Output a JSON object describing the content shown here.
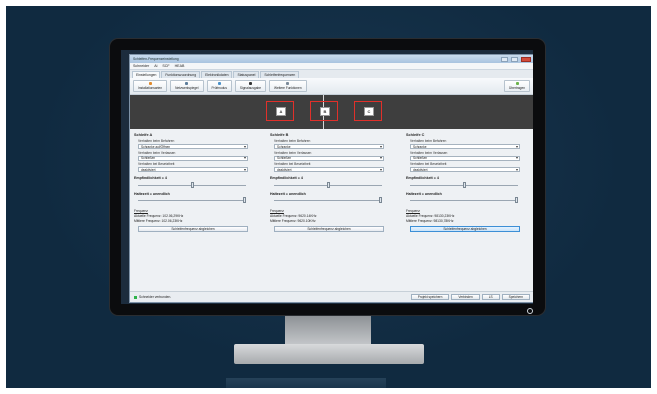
{
  "window": {
    "title": "Schleifen-Frequenzeinstellung"
  },
  "menu": [
    "Schneider",
    "Ai",
    "SCF",
    "HEAB"
  ],
  "tabs": [
    "Einstellungen",
    "Funktionszuordnung",
    "Elektronikdaten",
    "Statuspanel",
    "Schleifenfrequenzen"
  ],
  "toolbar": {
    "buttons": [
      {
        "label": "Installationsarten",
        "icon": "installation-icon",
        "color": "#e08a2c"
      },
      {
        "label": "Netzwerkspiegel",
        "icon": "network-icon",
        "color": "#5c7c9a"
      },
      {
        "label": "Prüfmodus",
        "icon": "test-icon",
        "color": "#4a90c8"
      },
      {
        "label": "Signalausgabe",
        "icon": "signal-icon",
        "color": "#333333"
      },
      {
        "label": "Weitere Funktionen",
        "icon": "more-icon",
        "color": "#7a8a99"
      }
    ],
    "right_button": {
      "label": "Übertragen",
      "icon": "transfer-icon",
      "color": "#6bb34a"
    }
  },
  "zones": [
    "A",
    "B",
    "C"
  ],
  "loops": [
    {
      "title": "Schleife A",
      "rows": [
        {
          "label": "Verhalten beim Befahren",
          "value": "Schranke auf/Öffnen"
        },
        {
          "label": "Verhalten beim Verlassen",
          "value": "Schließen"
        },
        {
          "label": "Verhalten bei Besetztheit",
          "value": "deaktiviert"
        }
      ],
      "sensitivity_label": "Empfindlichkeit = 4",
      "sensitivity_level": 0.5,
      "hold_label": "Haltezeit = unendlich",
      "hold_level": 1.0,
      "freq_title": "Frequenz",
      "freq_current": "Aktuelle Frequenz: 102.06,29KHz",
      "freq_avg": "Mittlere Frequenz: 102.06,23KHz",
      "button": "Schleifenfrequenz abgleichen",
      "button_highlighted": false
    },
    {
      "title": "Schleife B",
      "rows": [
        {
          "label": "Verhalten beim Befahren",
          "value": "Schranke"
        },
        {
          "label": "Verhalten beim Verlassen",
          "value": "Schließen"
        },
        {
          "label": "Verhalten bei Besetztheit",
          "value": "deaktiviert"
        }
      ],
      "sensitivity_label": "Empfindlichkeit = 4",
      "sensitivity_level": 0.5,
      "hold_label": "Haltezeit = unendlich",
      "hold_level": 1.0,
      "freq_title": "Frequenz",
      "freq_current": "Aktuelle Frequenz: 9620.14KHz",
      "freq_avg": "Mittlere Frequenz: 9620.10KHz",
      "button": "Schleifenfrequenz abgleichen",
      "button_highlighted": false
    },
    {
      "title": "Schleife C",
      "rows": [
        {
          "label": "Verhalten beim Befahren",
          "value": "Schranke"
        },
        {
          "label": "Verhalten beim Verlassen",
          "value": "Schließen"
        },
        {
          "label": "Verhalten bei Besetztheit",
          "value": "deaktiviert"
        }
      ],
      "sensitivity_label": "Empfindlichkeit = 4",
      "sensitivity_level": 0.5,
      "hold_label": "Haltezeit = unendlich",
      "hold_level": 1.0,
      "freq_title": "Frequenz",
      "freq_current": "Aktuelle Frequenz: 98130,23KHz",
      "freq_avg": "Mittlere Frequenz: 98130,78KHz",
      "button": "Schleifenfrequenz abgleichen",
      "button_highlighted": true
    }
  ],
  "status": {
    "text": "Schneider verbunden."
  },
  "footer_buttons": [
    "Projekt speichern",
    "Verbinden",
    "LS",
    "Speichern"
  ]
}
